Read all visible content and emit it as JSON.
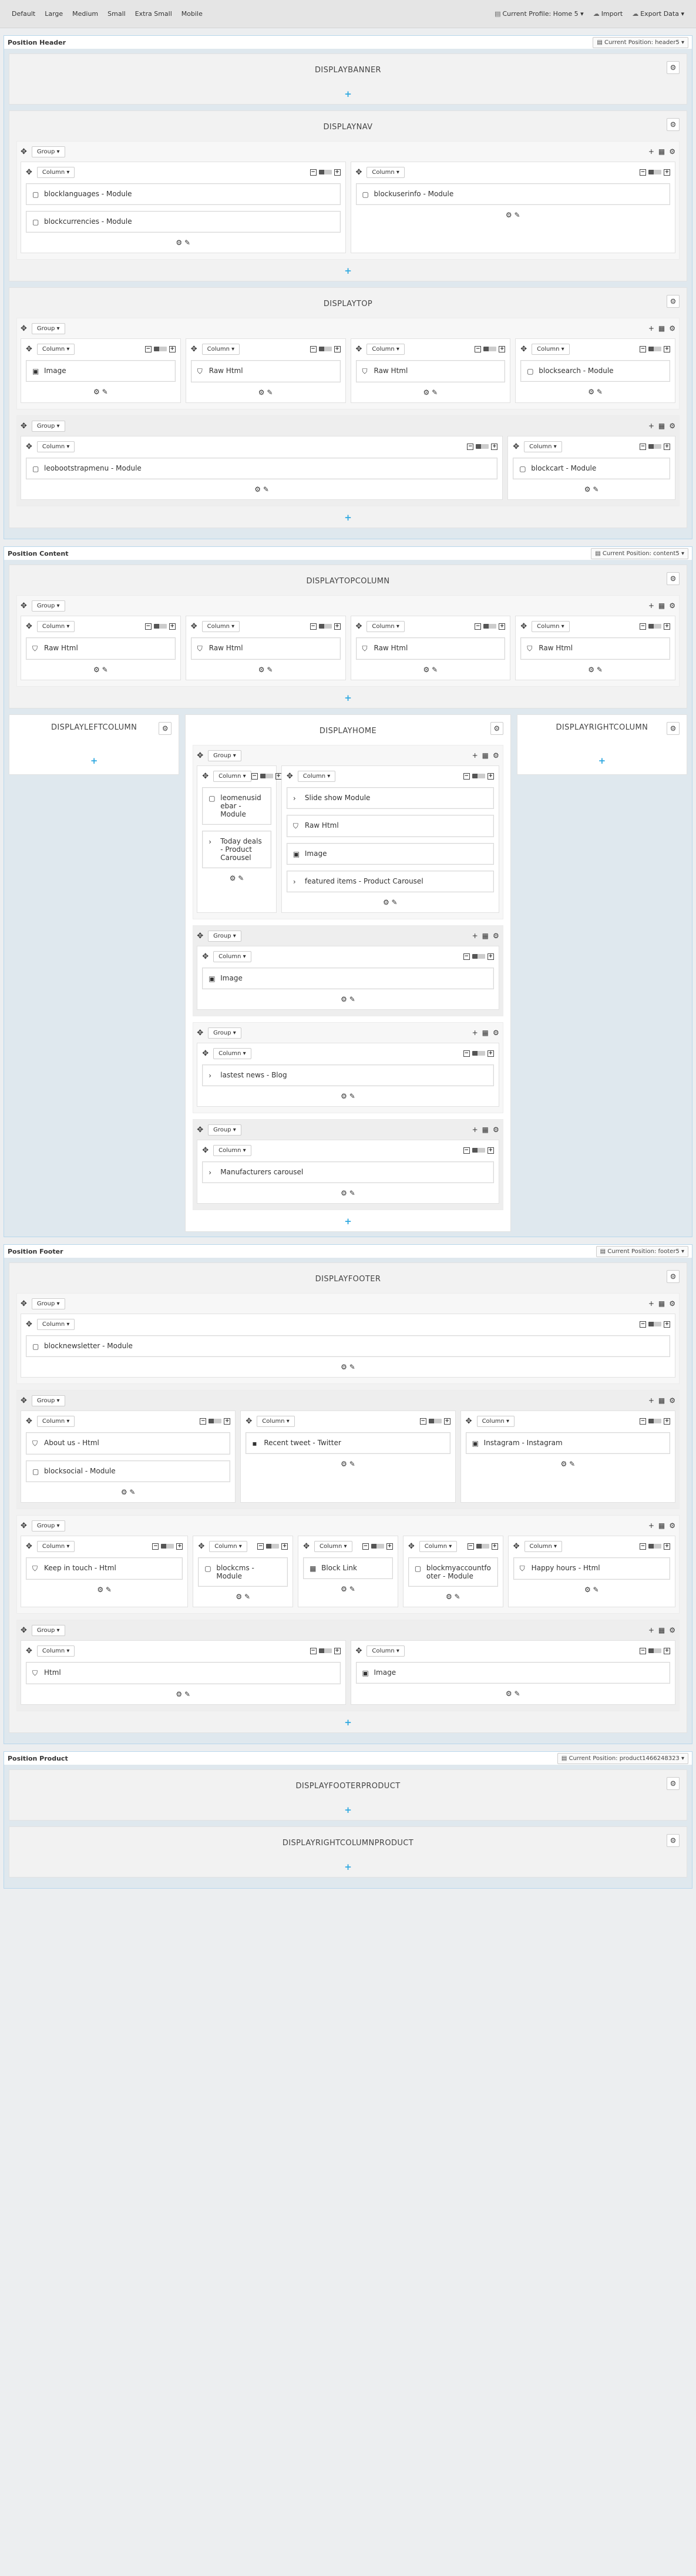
{
  "toolbar": {
    "left": [
      "Default",
      "Large",
      "Medium",
      "Small",
      "Extra Small",
      "Mobile"
    ],
    "right": [
      {
        "icon": "▤",
        "label": "Current Profile: Home 5 ▾"
      },
      {
        "icon": "☁",
        "label": "Import"
      },
      {
        "icon": "☁",
        "label": "Export Data ▾"
      }
    ]
  },
  "labels": {
    "group": "Group ▾",
    "column": "Column ▾",
    "plus": "+",
    "gear": "⚙",
    "footer_icons": "⚙ ✎",
    "move": "✥"
  },
  "positions": [
    {
      "title": "Position Header",
      "profile": "▤ Current Position: header5 ▾",
      "hooks": [
        {
          "name": "DISPLAYBANNER",
          "groups": []
        },
        {
          "name": "DISPLAYNAV",
          "groups": [
            {
              "cols": [
                {
                  "w": 1,
                  "widgets": [
                    {
                      "i": "▢",
                      "t": "blocklanguages - Module"
                    },
                    {
                      "i": "▢",
                      "t": "blockcurrencies - Module"
                    }
                  ]
                },
                {
                  "w": 1,
                  "widgets": [
                    {
                      "i": "▢",
                      "t": "blockuserinfo - Module"
                    }
                  ]
                }
              ]
            }
          ]
        },
        {
          "name": "DISPLAYTOP",
          "groups": [
            {
              "cols": [
                {
                  "w": 1,
                  "widgets": [
                    {
                      "i": "▣",
                      "t": "Image"
                    }
                  ]
                },
                {
                  "w": 1,
                  "widgets": [
                    {
                      "i": "⛉",
                      "t": "Raw Html"
                    }
                  ]
                },
                {
                  "w": 1,
                  "widgets": [
                    {
                      "i": "⛉",
                      "t": "Raw Html"
                    }
                  ]
                },
                {
                  "w": 1,
                  "widgets": [
                    {
                      "i": "▢",
                      "t": "blocksearch - Module"
                    }
                  ]
                }
              ]
            },
            {
              "cols": [
                {
                  "w": 3,
                  "widgets": [
                    {
                      "i": "▢",
                      "t": "leobootstrapmenu - Module"
                    }
                  ]
                },
                {
                  "w": 1,
                  "widgets": [
                    {
                      "i": "▢",
                      "t": "blockcart - Module"
                    }
                  ]
                }
              ]
            }
          ]
        }
      ]
    },
    {
      "title": "Position Content",
      "profile": "▤ Current Position: content5 ▾",
      "hooks": [
        {
          "name": "DISPLAYTOPCOLUMN",
          "groups": [
            {
              "cols": [
                {
                  "w": 1,
                  "widgets": [
                    {
                      "i": "⛉",
                      "t": "Raw Html"
                    }
                  ]
                },
                {
                  "w": 1,
                  "widgets": [
                    {
                      "i": "⛉",
                      "t": "Raw Html"
                    }
                  ]
                },
                {
                  "w": 1,
                  "widgets": [
                    {
                      "i": "⛉",
                      "t": "Raw Html"
                    }
                  ]
                },
                {
                  "w": 1,
                  "widgets": [
                    {
                      "i": "⛉",
                      "t": "Raw Html"
                    }
                  ]
                }
              ]
            }
          ]
        }
      ],
      "three": {
        "left": "DISPLAYLEFTCOLUMN",
        "right": "DISPLAYRIGHTCOLUMN",
        "center": {
          "name": "DISPLAYHOME",
          "groups": [
            {
              "cols": [
                {
                  "w": 1,
                  "widgets": [
                    {
                      "i": "▢",
                      "t": "leomenusidebar - Module"
                    },
                    {
                      "i": "›",
                      "t": "Today deals - Product Carousel"
                    }
                  ]
                },
                {
                  "w": 3,
                  "widgets": [
                    {
                      "i": "›",
                      "t": "Slide show Module"
                    },
                    {
                      "i": "⛉",
                      "t": "Raw Html"
                    },
                    {
                      "i": "▣",
                      "t": "Image"
                    },
                    {
                      "i": "›",
                      "t": "featured items - Product Carousel"
                    }
                  ]
                }
              ]
            },
            {
              "cols": [
                {
                  "w": 1,
                  "widgets": [
                    {
                      "i": "▣",
                      "t": "Image"
                    }
                  ]
                }
              ]
            },
            {
              "cols": [
                {
                  "w": 1,
                  "widgets": [
                    {
                      "i": "›",
                      "t": "lastest news - Blog"
                    }
                  ]
                }
              ]
            },
            {
              "cols": [
                {
                  "w": 1,
                  "widgets": [
                    {
                      "i": "›",
                      "t": "Manufacturers carousel"
                    }
                  ]
                }
              ]
            }
          ]
        }
      }
    },
    {
      "title": "Position Footer",
      "profile": "▤ Current Position: footer5 ▾",
      "hooks": [
        {
          "name": "DISPLAYFOOTER",
          "groups": [
            {
              "cols": [
                {
                  "w": 1,
                  "widgets": [
                    {
                      "i": "▢",
                      "t": "blocknewsletter - Module"
                    }
                  ]
                }
              ]
            },
            {
              "cols": [
                {
                  "w": 1,
                  "widgets": [
                    {
                      "i": "⛉",
                      "t": "About us - Html"
                    },
                    {
                      "i": "▢",
                      "t": "blocksocial - Module"
                    }
                  ]
                },
                {
                  "w": 1,
                  "widgets": [
                    {
                      "i": "▪",
                      "t": "Recent tweet - Twitter"
                    }
                  ]
                },
                {
                  "w": 1,
                  "widgets": [
                    {
                      "i": "▣",
                      "t": "Instagram - Instagram"
                    }
                  ]
                }
              ]
            },
            {
              "cols": [
                {
                  "w": 1.4,
                  "widgets": [
                    {
                      "i": "⛉",
                      "t": "Keep in touch - Html"
                    }
                  ]
                },
                {
                  "w": 0.8,
                  "widgets": [
                    {
                      "i": "▢",
                      "t": "blockcms - Module"
                    }
                  ]
                },
                {
                  "w": 0.8,
                  "widgets": [
                    {
                      "i": "▦",
                      "t": "Block Link"
                    }
                  ]
                },
                {
                  "w": 0.8,
                  "widgets": [
                    {
                      "i": "▢",
                      "t": "blockmyaccountfooter - Module"
                    }
                  ]
                },
                {
                  "w": 1.4,
                  "widgets": [
                    {
                      "i": "⛉",
                      "t": "Happy hours - Html"
                    }
                  ]
                }
              ]
            },
            {
              "cols": [
                {
                  "w": 1,
                  "widgets": [
                    {
                      "i": "⛉",
                      "t": "Html"
                    }
                  ]
                },
                {
                  "w": 1,
                  "widgets": [
                    {
                      "i": "▣",
                      "t": "Image"
                    }
                  ]
                }
              ]
            }
          ]
        }
      ]
    },
    {
      "title": "Position Product",
      "profile": "▤ Current Position: product1466248323 ▾",
      "hooks": [
        {
          "name": "DISPLAYFOOTERPRODUCT",
          "groups": []
        },
        {
          "name": "DISPLAYRIGHTCOLUMNPRODUCT",
          "groups": []
        }
      ]
    }
  ]
}
